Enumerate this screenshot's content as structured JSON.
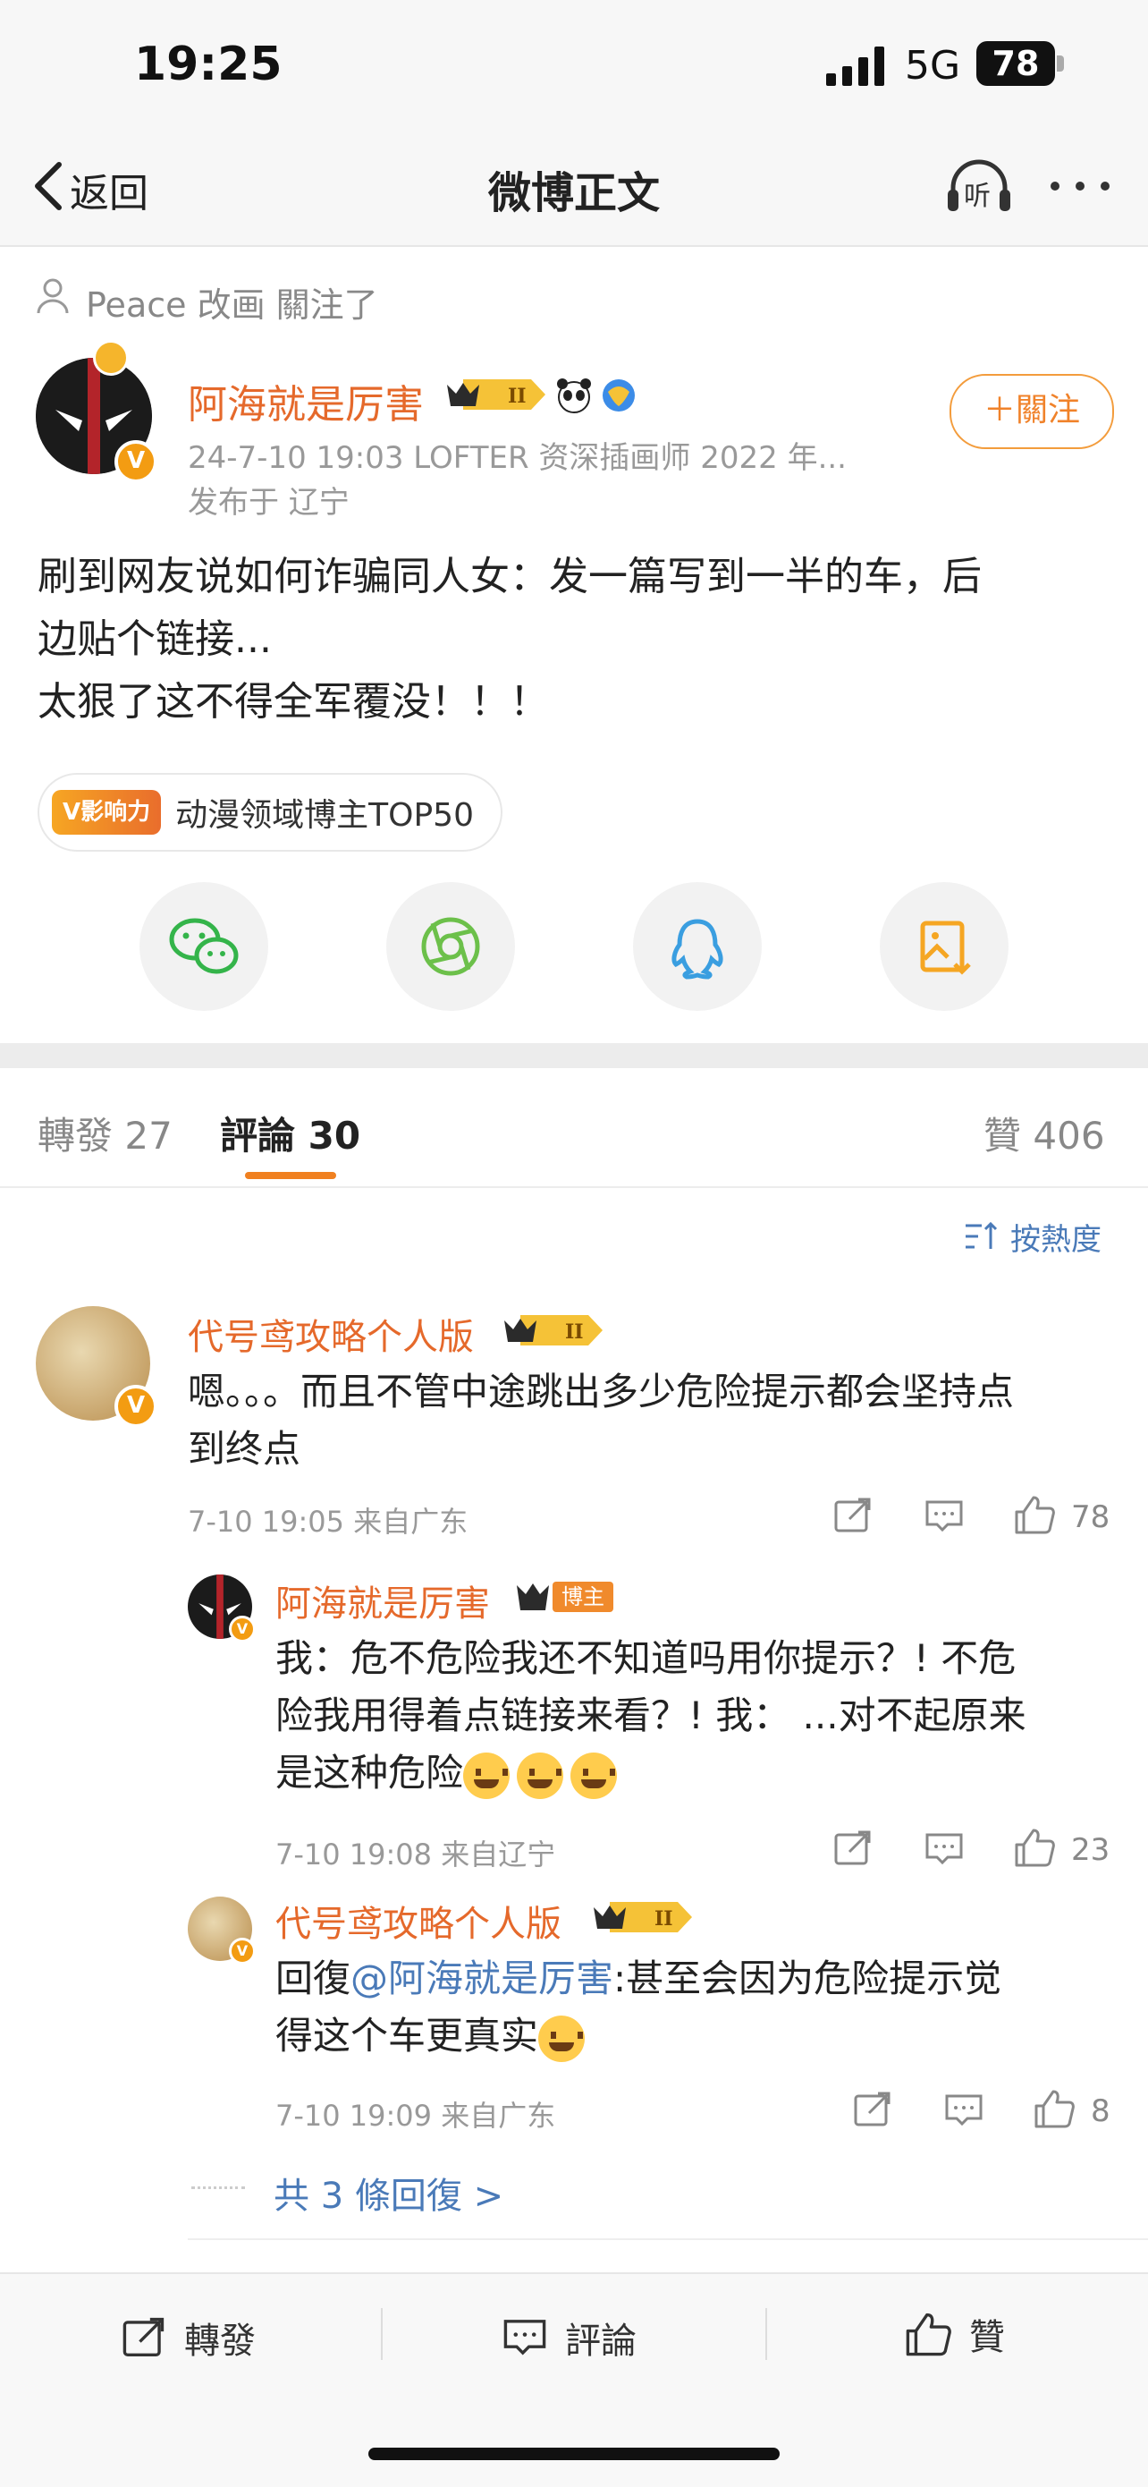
{
  "status_bar": {
    "time": "19:25",
    "network": "5G",
    "battery": "78"
  },
  "nav": {
    "back_label": "返回",
    "title": "微博正文",
    "listen_icon_label": "听"
  },
  "post": {
    "follow_note": "Peace 改画 關注了",
    "author": "阿海就是厉害",
    "meta": "24-7-10 19:03  LOFTER 资深插画师  2022 年...",
    "location": "发布于 辽宁",
    "follow_button": "＋關注",
    "text_lines": [
      "刷到网友说如何诈骗同人女：发一篇写到一半的车，后",
      "边贴个链接...",
      "太狠了这不得全军覆没！！！"
    ],
    "tag_badge": "V影响力",
    "tag_text": "动漫领域博主TOP50"
  },
  "tabs": {
    "repost_label": "轉發",
    "repost_count": "27",
    "comment_label": "評論",
    "comment_count": "30",
    "like_label": "贊",
    "like_count": "406"
  },
  "sort_label": "按熱度",
  "comments": [
    {
      "name": "代号鸢攻略个人版",
      "text_lines": [
        "嗯。。。而且不管中途跳出多少危险提示都会坚持点",
        "到终点"
      ],
      "meta": "7-10 19:05  来自广东",
      "likes": "78"
    }
  ],
  "replies": [
    {
      "name": "阿海就是厉害",
      "badge": "博主",
      "text_lines": [
        "我：危不危险我还不知道吗用你提示？! 不危",
        "险我用得着点链接来看？! 我：  ...对不起原来",
        "是这种危险"
      ],
      "meta": "7-10 19:08  来自辽宁",
      "likes": "23"
    },
    {
      "name": "代号鸢攻略个人版",
      "reply_prefix": "回復",
      "mention": "@阿海就是厉害",
      "text_lines": [
        ":甚至会因为危险提示觉",
        "得这个车更真实"
      ],
      "meta": "7-10 19:09  来自广东",
      "likes": "8"
    }
  ],
  "more_replies": "共 3 條回復 >",
  "bottom_bar": {
    "repost": "轉發",
    "comment": "評論",
    "like": "贊"
  },
  "colors": {
    "accent": "#e5692b",
    "link": "#4a7ab8",
    "tab_underline": "#f08020"
  }
}
